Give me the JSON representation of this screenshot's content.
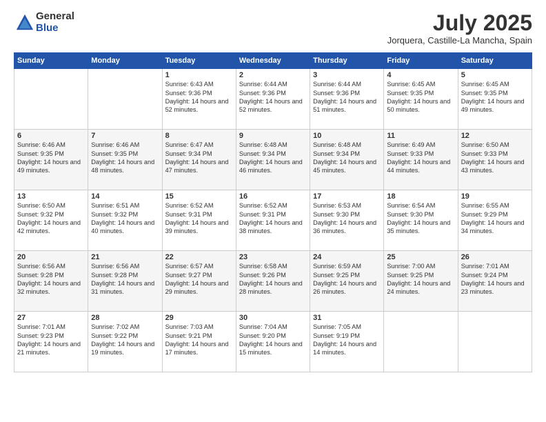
{
  "logo": {
    "general": "General",
    "blue": "Blue"
  },
  "title": "July 2025",
  "subtitle": "Jorquera, Castille-La Mancha, Spain",
  "headers": [
    "Sunday",
    "Monday",
    "Tuesday",
    "Wednesday",
    "Thursday",
    "Friday",
    "Saturday"
  ],
  "weeks": [
    [
      {
        "day": "",
        "sunrise": "",
        "sunset": "",
        "daylight": ""
      },
      {
        "day": "",
        "sunrise": "",
        "sunset": "",
        "daylight": ""
      },
      {
        "day": "1",
        "sunrise": "Sunrise: 6:43 AM",
        "sunset": "Sunset: 9:36 PM",
        "daylight": "Daylight: 14 hours and 52 minutes."
      },
      {
        "day": "2",
        "sunrise": "Sunrise: 6:44 AM",
        "sunset": "Sunset: 9:36 PM",
        "daylight": "Daylight: 14 hours and 52 minutes."
      },
      {
        "day": "3",
        "sunrise": "Sunrise: 6:44 AM",
        "sunset": "Sunset: 9:36 PM",
        "daylight": "Daylight: 14 hours and 51 minutes."
      },
      {
        "day": "4",
        "sunrise": "Sunrise: 6:45 AM",
        "sunset": "Sunset: 9:35 PM",
        "daylight": "Daylight: 14 hours and 50 minutes."
      },
      {
        "day": "5",
        "sunrise": "Sunrise: 6:45 AM",
        "sunset": "Sunset: 9:35 PM",
        "daylight": "Daylight: 14 hours and 49 minutes."
      }
    ],
    [
      {
        "day": "6",
        "sunrise": "Sunrise: 6:46 AM",
        "sunset": "Sunset: 9:35 PM",
        "daylight": "Daylight: 14 hours and 49 minutes."
      },
      {
        "day": "7",
        "sunrise": "Sunrise: 6:46 AM",
        "sunset": "Sunset: 9:35 PM",
        "daylight": "Daylight: 14 hours and 48 minutes."
      },
      {
        "day": "8",
        "sunrise": "Sunrise: 6:47 AM",
        "sunset": "Sunset: 9:34 PM",
        "daylight": "Daylight: 14 hours and 47 minutes."
      },
      {
        "day": "9",
        "sunrise": "Sunrise: 6:48 AM",
        "sunset": "Sunset: 9:34 PM",
        "daylight": "Daylight: 14 hours and 46 minutes."
      },
      {
        "day": "10",
        "sunrise": "Sunrise: 6:48 AM",
        "sunset": "Sunset: 9:34 PM",
        "daylight": "Daylight: 14 hours and 45 minutes."
      },
      {
        "day": "11",
        "sunrise": "Sunrise: 6:49 AM",
        "sunset": "Sunset: 9:33 PM",
        "daylight": "Daylight: 14 hours and 44 minutes."
      },
      {
        "day": "12",
        "sunrise": "Sunrise: 6:50 AM",
        "sunset": "Sunset: 9:33 PM",
        "daylight": "Daylight: 14 hours and 43 minutes."
      }
    ],
    [
      {
        "day": "13",
        "sunrise": "Sunrise: 6:50 AM",
        "sunset": "Sunset: 9:32 PM",
        "daylight": "Daylight: 14 hours and 42 minutes."
      },
      {
        "day": "14",
        "sunrise": "Sunrise: 6:51 AM",
        "sunset": "Sunset: 9:32 PM",
        "daylight": "Daylight: 14 hours and 40 minutes."
      },
      {
        "day": "15",
        "sunrise": "Sunrise: 6:52 AM",
        "sunset": "Sunset: 9:31 PM",
        "daylight": "Daylight: 14 hours and 39 minutes."
      },
      {
        "day": "16",
        "sunrise": "Sunrise: 6:52 AM",
        "sunset": "Sunset: 9:31 PM",
        "daylight": "Daylight: 14 hours and 38 minutes."
      },
      {
        "day": "17",
        "sunrise": "Sunrise: 6:53 AM",
        "sunset": "Sunset: 9:30 PM",
        "daylight": "Daylight: 14 hours and 36 minutes."
      },
      {
        "day": "18",
        "sunrise": "Sunrise: 6:54 AM",
        "sunset": "Sunset: 9:30 PM",
        "daylight": "Daylight: 14 hours and 35 minutes."
      },
      {
        "day": "19",
        "sunrise": "Sunrise: 6:55 AM",
        "sunset": "Sunset: 9:29 PM",
        "daylight": "Daylight: 14 hours and 34 minutes."
      }
    ],
    [
      {
        "day": "20",
        "sunrise": "Sunrise: 6:56 AM",
        "sunset": "Sunset: 9:28 PM",
        "daylight": "Daylight: 14 hours and 32 minutes."
      },
      {
        "day": "21",
        "sunrise": "Sunrise: 6:56 AM",
        "sunset": "Sunset: 9:28 PM",
        "daylight": "Daylight: 14 hours and 31 minutes."
      },
      {
        "day": "22",
        "sunrise": "Sunrise: 6:57 AM",
        "sunset": "Sunset: 9:27 PM",
        "daylight": "Daylight: 14 hours and 29 minutes."
      },
      {
        "day": "23",
        "sunrise": "Sunrise: 6:58 AM",
        "sunset": "Sunset: 9:26 PM",
        "daylight": "Daylight: 14 hours and 28 minutes."
      },
      {
        "day": "24",
        "sunrise": "Sunrise: 6:59 AM",
        "sunset": "Sunset: 9:25 PM",
        "daylight": "Daylight: 14 hours and 26 minutes."
      },
      {
        "day": "25",
        "sunrise": "Sunrise: 7:00 AM",
        "sunset": "Sunset: 9:25 PM",
        "daylight": "Daylight: 14 hours and 24 minutes."
      },
      {
        "day": "26",
        "sunrise": "Sunrise: 7:01 AM",
        "sunset": "Sunset: 9:24 PM",
        "daylight": "Daylight: 14 hours and 23 minutes."
      }
    ],
    [
      {
        "day": "27",
        "sunrise": "Sunrise: 7:01 AM",
        "sunset": "Sunset: 9:23 PM",
        "daylight": "Daylight: 14 hours and 21 minutes."
      },
      {
        "day": "28",
        "sunrise": "Sunrise: 7:02 AM",
        "sunset": "Sunset: 9:22 PM",
        "daylight": "Daylight: 14 hours and 19 minutes."
      },
      {
        "day": "29",
        "sunrise": "Sunrise: 7:03 AM",
        "sunset": "Sunset: 9:21 PM",
        "daylight": "Daylight: 14 hours and 17 minutes."
      },
      {
        "day": "30",
        "sunrise": "Sunrise: 7:04 AM",
        "sunset": "Sunset: 9:20 PM",
        "daylight": "Daylight: 14 hours and 15 minutes."
      },
      {
        "day": "31",
        "sunrise": "Sunrise: 7:05 AM",
        "sunset": "Sunset: 9:19 PM",
        "daylight": "Daylight: 14 hours and 14 minutes."
      },
      {
        "day": "",
        "sunrise": "",
        "sunset": "",
        "daylight": ""
      },
      {
        "day": "",
        "sunrise": "",
        "sunset": "",
        "daylight": ""
      }
    ]
  ]
}
